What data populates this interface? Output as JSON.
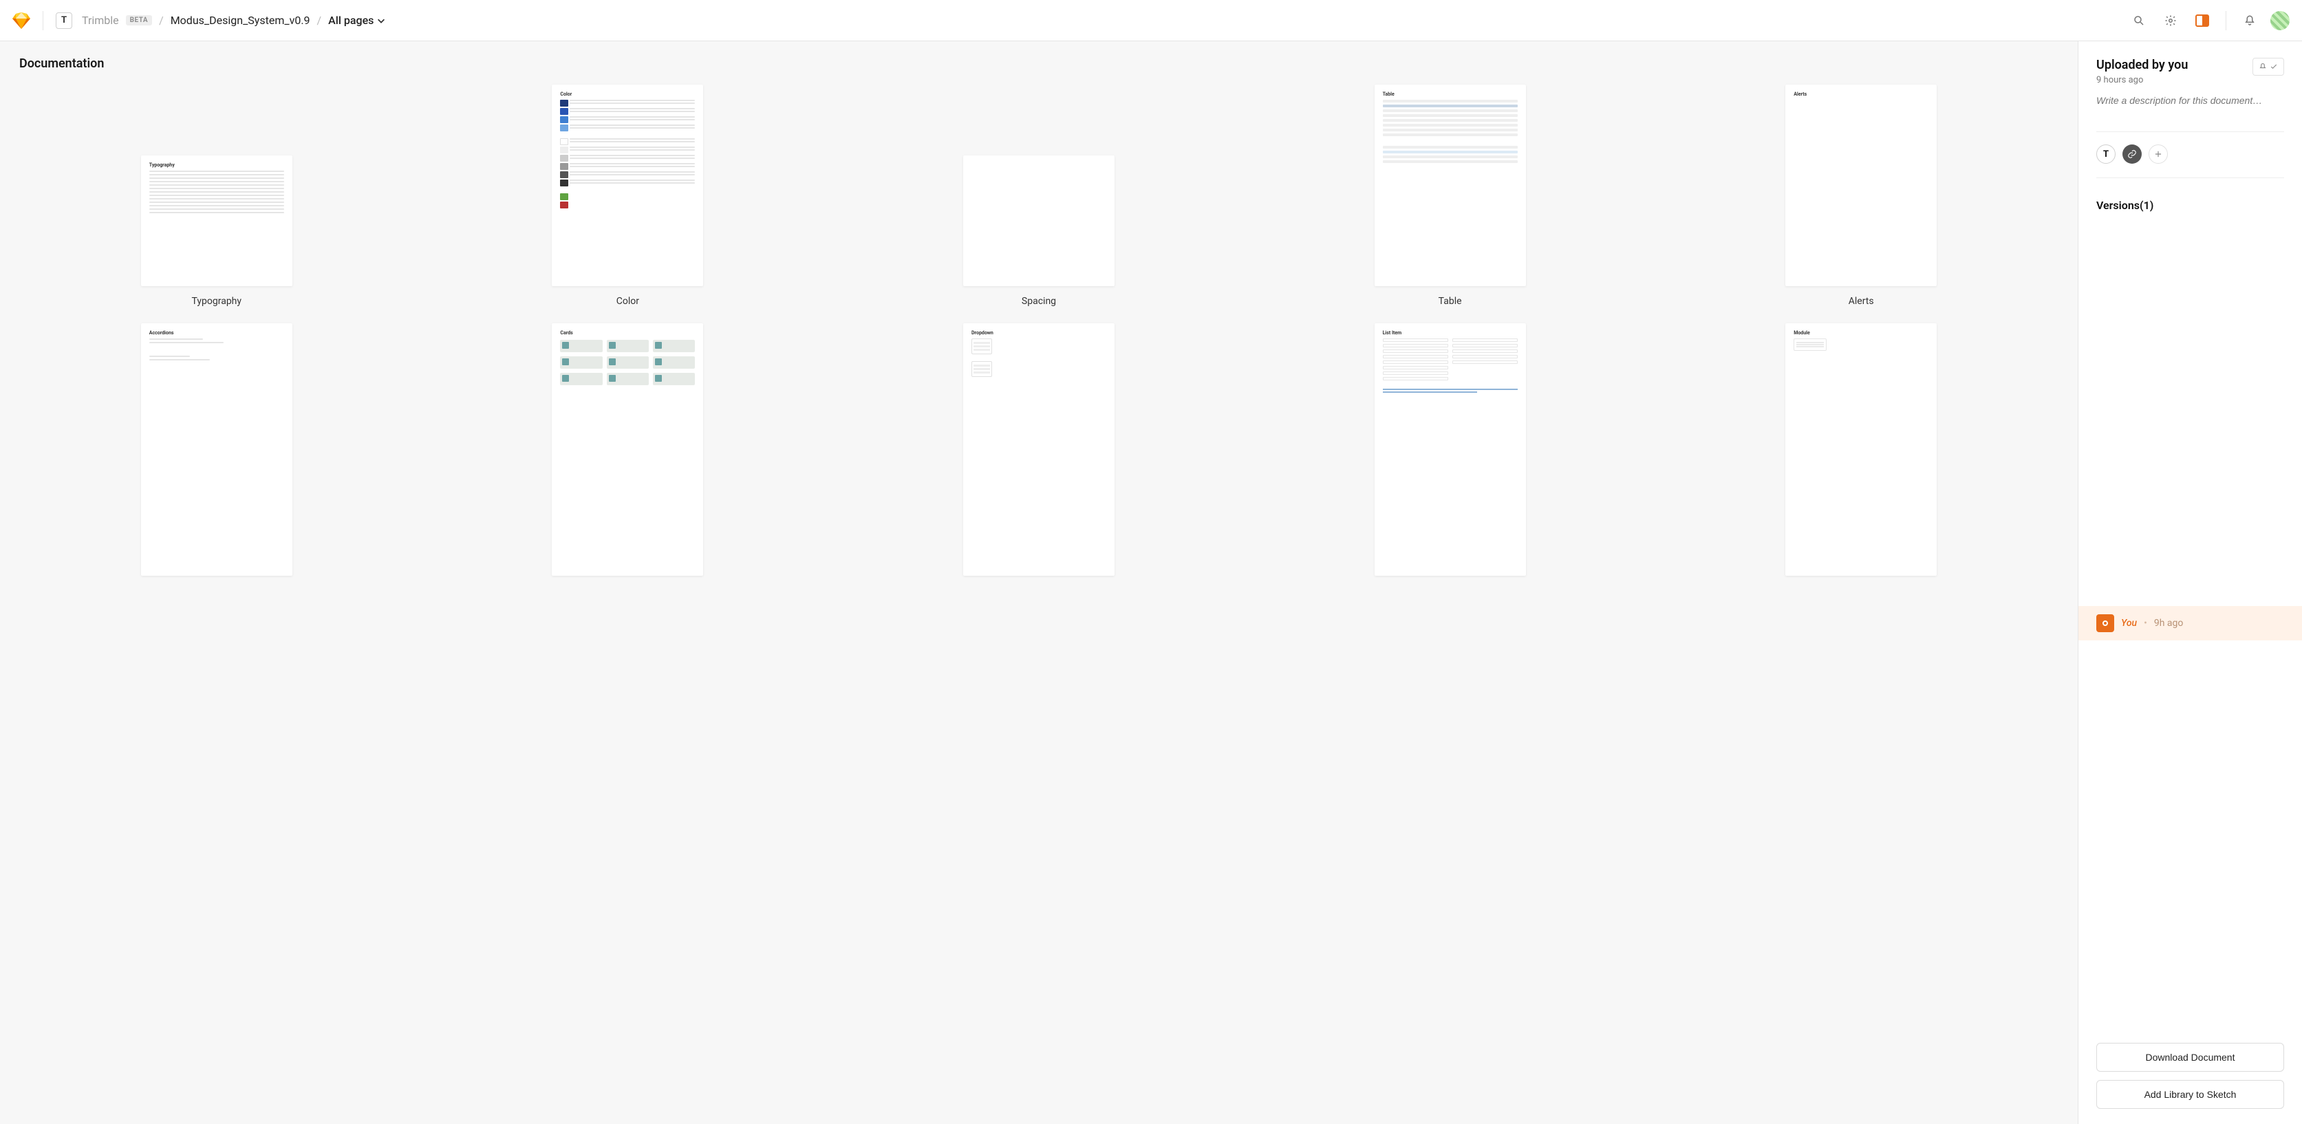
{
  "header": {
    "workspace_initial": "T",
    "workspace_name": "Trimble",
    "beta_label": "BETA",
    "document_name": "Modus_Design_System_v0.9",
    "page_selector": "All pages"
  },
  "page": {
    "title": "Documentation"
  },
  "artboards": {
    "row1": [
      {
        "label": "Typography",
        "thumb_title": "Typography"
      },
      {
        "label": "Color",
        "thumb_title": "Color"
      },
      {
        "label": "Spacing",
        "thumb_title": ""
      },
      {
        "label": "Table",
        "thumb_title": "Table"
      },
      {
        "label": "Alerts",
        "thumb_title": "Alerts"
      }
    ],
    "row2": [
      {
        "label": "",
        "thumb_title": "Accordions"
      },
      {
        "label": "",
        "thumb_title": "Cards"
      },
      {
        "label": "",
        "thumb_title": "Dropdown"
      },
      {
        "label": "",
        "thumb_title": "List Item"
      },
      {
        "label": "",
        "thumb_title": "Module"
      }
    ]
  },
  "sidebar": {
    "uploaded_by": "Uploaded by you",
    "timestamp": "9 hours ago",
    "description_placeholder": "Write a description for this document…",
    "share_initial": "T",
    "versions_title": "Versions(1)",
    "version": {
      "author": "You",
      "separator": "•",
      "time": "9h ago"
    },
    "buttons": {
      "download": "Download Document",
      "add_library": "Add Library to Sketch"
    }
  },
  "colors": {
    "accent": "#e86c1a",
    "swatches_primary": [
      "#1f3a7a",
      "#2a55b3",
      "#3f7fd1",
      "#6fa6e2"
    ],
    "swatches_green": "#5fa341",
    "swatches_red": "#b83232"
  }
}
